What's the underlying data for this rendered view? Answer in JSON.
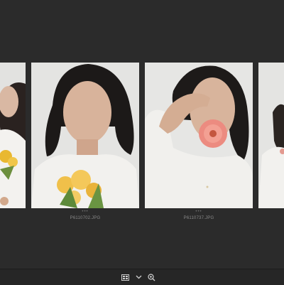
{
  "filmstrip": {
    "photos": [
      {
        "filename": "",
        "rating": ""
      },
      {
        "filename": "P6110702.JPG",
        "rating": "•••"
      },
      {
        "filename": "P6110737.JPG",
        "rating": "•••"
      },
      {
        "filename": "",
        "rating": ""
      }
    ]
  },
  "toolbar": {
    "view_icon": "grid-view-icon",
    "menu_icon": "chevron-down-icon",
    "zoom_icon": "zoom-in-icon"
  },
  "colors": {
    "background": "#2b2b2b",
    "bar": "#262626",
    "filename_text": "#8a8a8a"
  }
}
